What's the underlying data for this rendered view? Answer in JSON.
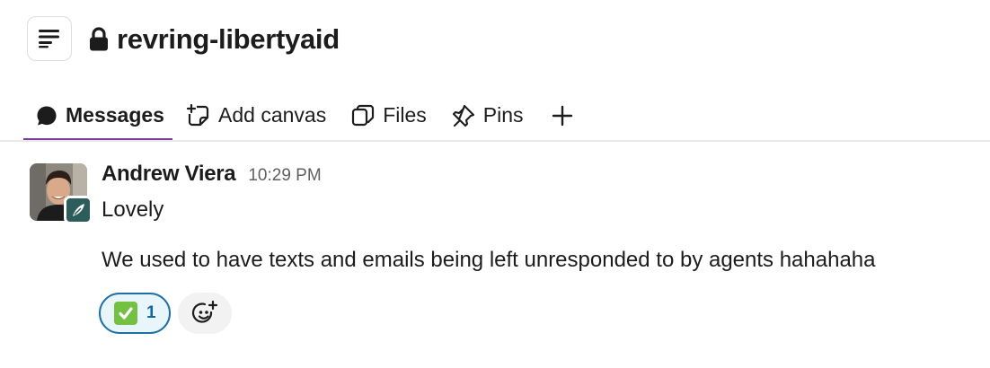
{
  "header": {
    "menu_icon": "channel-list-icon",
    "lock_icon": "lock-icon",
    "channel_name": "revring-libertyaid"
  },
  "tabs": [
    {
      "label": "Messages",
      "icon": "messages-bubble-icon",
      "active": true
    },
    {
      "label": "Add canvas",
      "icon": "add-canvas-icon",
      "active": false
    },
    {
      "label": "Files",
      "icon": "files-icon",
      "active": false
    },
    {
      "label": "Pins",
      "icon": "pin-icon",
      "active": false
    }
  ],
  "add_tab_icon": "plus-icon",
  "message": {
    "sender": "Andrew Viera",
    "time": "10:29 PM",
    "lines": [
      "Lovely",
      "We used to have texts and emails being left unresponded to by agents hahahaha"
    ],
    "reactions": [
      {
        "emoji": "white-check-mark",
        "count": "1"
      }
    ],
    "add_reaction_icon": "add-reaction-icon"
  },
  "colors": {
    "active_tab_underline": "#7d3c98",
    "reaction_border": "#1d6fa5",
    "reaction_bg": "#e8f5fa",
    "badge_bg": "#2c5d5b"
  }
}
